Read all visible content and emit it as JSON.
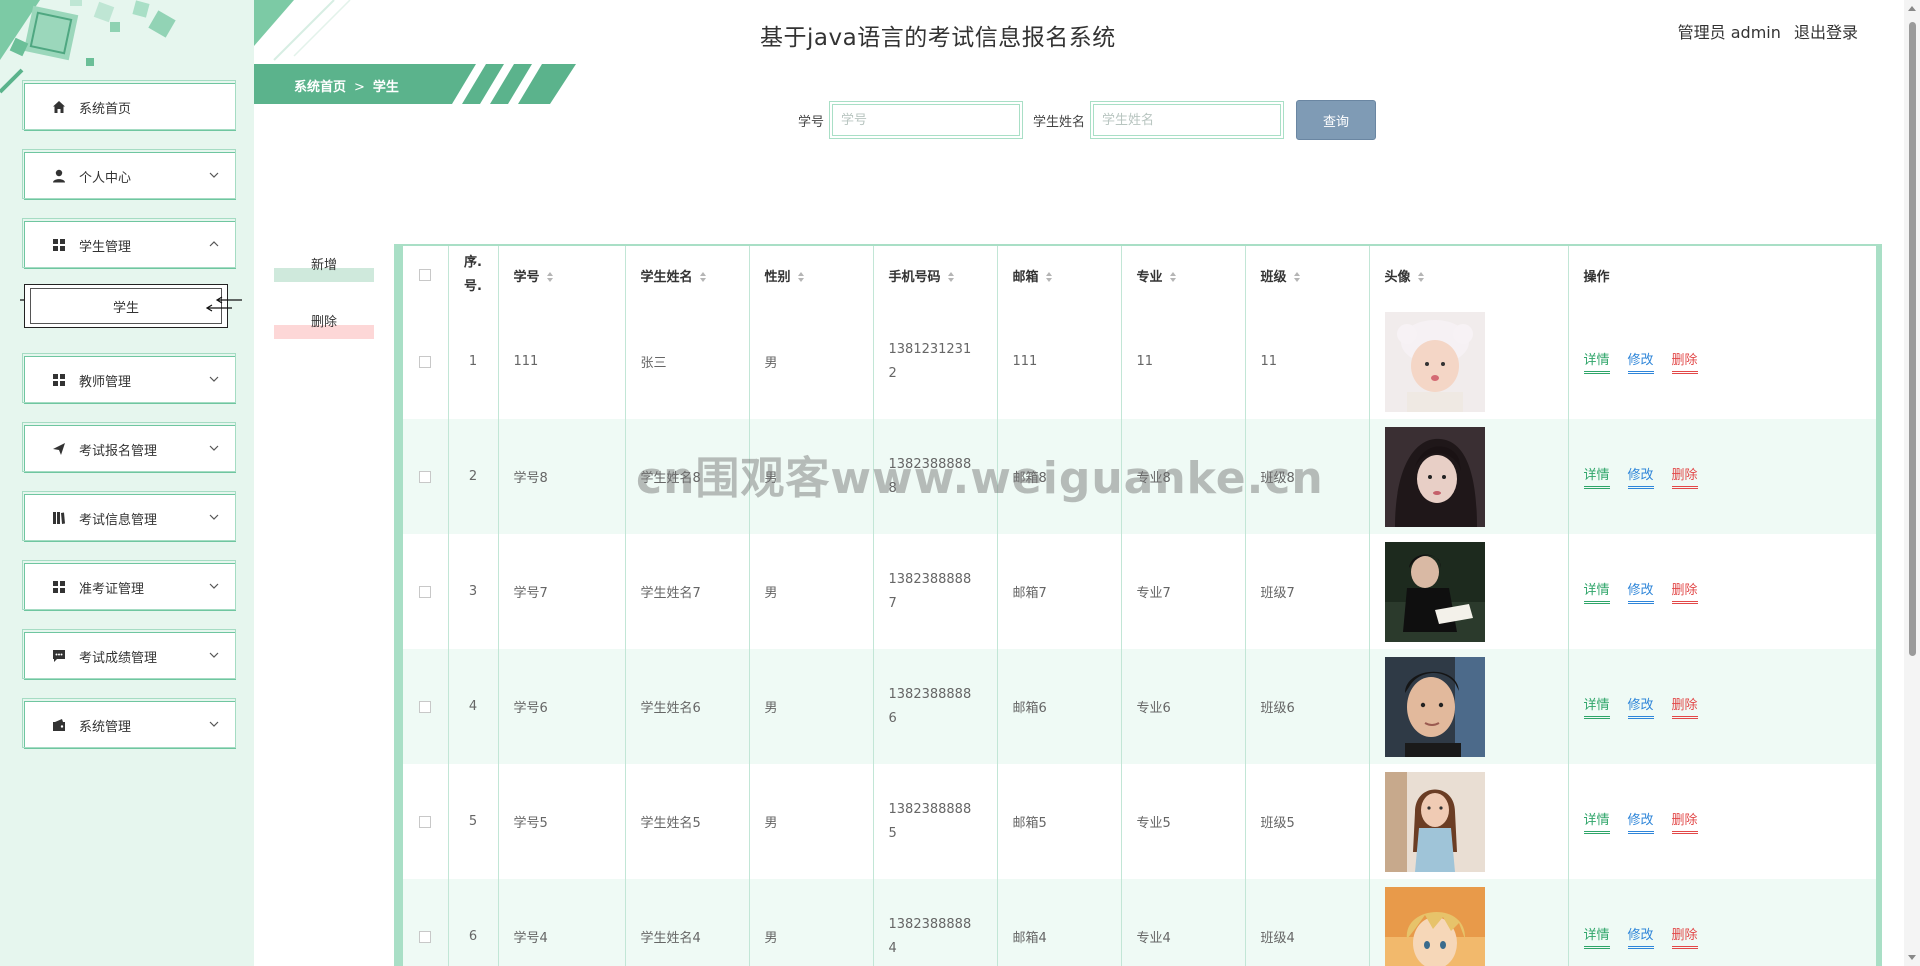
{
  "app": {
    "title": "基于java语言的考试信息报名系统",
    "user_label": "管理员 admin",
    "logout_label": "退出登录"
  },
  "sidebar": {
    "items": [
      {
        "label": "系统首页",
        "icon": "home-icon",
        "expanded": false,
        "has_chevron": false
      },
      {
        "label": "个人中心",
        "icon": "person-icon",
        "expanded": false,
        "has_chevron": true
      },
      {
        "label": "学生管理",
        "icon": "grid-icon",
        "expanded": true,
        "has_chevron": true
      },
      {
        "label": "教师管理",
        "icon": "grid-icon",
        "expanded": false,
        "has_chevron": true
      },
      {
        "label": "考试报名管理",
        "icon": "send-icon",
        "expanded": false,
        "has_chevron": true
      },
      {
        "label": "考试信息管理",
        "icon": "book-icon",
        "expanded": false,
        "has_chevron": true
      },
      {
        "label": "准考证管理",
        "icon": "grid-icon",
        "expanded": false,
        "has_chevron": true
      },
      {
        "label": "考试成绩管理",
        "icon": "chat-icon",
        "expanded": false,
        "has_chevron": true
      },
      {
        "label": "系统管理",
        "icon": "wallet-icon",
        "expanded": false,
        "has_chevron": true
      }
    ],
    "sub_item": {
      "label": "学生"
    }
  },
  "breadcrumb": {
    "home": "系统首页",
    "separator": ">",
    "current": "学生"
  },
  "search": {
    "student_no_label": "学号",
    "student_no_placeholder": "学号",
    "student_no_value": "",
    "student_name_label": "学生姓名",
    "student_name_placeholder": "学生姓名",
    "student_name_value": "",
    "button": "查询"
  },
  "actions": {
    "add": "新增",
    "delete": "删除"
  },
  "table": {
    "headers": {
      "index": "序.号.",
      "student_no": "学号",
      "student_name": "学生姓名",
      "gender": "性别",
      "phone": "手机号码",
      "email": "邮箱",
      "major": "专业",
      "class": "班级",
      "avatar": "头像",
      "ops": "操作"
    },
    "rows": [
      {
        "index": "1",
        "student_no": "111",
        "student_name": "张三",
        "gender": "男",
        "phone": "13812312312",
        "email": "111",
        "major": "11",
        "class": "11",
        "avatar": "girl-child-photo"
      },
      {
        "index": "2",
        "student_no": "学号8",
        "student_name": "学生姓名8",
        "gender": "男",
        "phone": "13823888888",
        "email": "邮箱8",
        "major": "专业8",
        "class": "班级8",
        "avatar": "woman-selfie-photo"
      },
      {
        "index": "3",
        "student_no": "学号7",
        "student_name": "学生姓名7",
        "gender": "男",
        "phone": "13823888887",
        "email": "邮箱7",
        "major": "专业7",
        "class": "班级7",
        "avatar": "man-reading-photo"
      },
      {
        "index": "4",
        "student_no": "学号6",
        "student_name": "学生姓名6",
        "gender": "男",
        "phone": "13823888886",
        "email": "邮箱6",
        "major": "专业6",
        "class": "班级6",
        "avatar": "man-portrait-photo"
      },
      {
        "index": "5",
        "student_no": "学号5",
        "student_name": "学生姓名5",
        "gender": "男",
        "phone": "13823888885",
        "email": "邮箱5",
        "major": "专业5",
        "class": "班级5",
        "avatar": "woman-street-photo"
      },
      {
        "index": "6",
        "student_no": "学号4",
        "student_name": "学生姓名4",
        "gender": "男",
        "phone": "13823888884",
        "email": "邮箱4",
        "major": "专业4",
        "class": "班级4",
        "avatar": "anime-boy-illustration"
      }
    ],
    "op_labels": {
      "detail": "详情",
      "edit": "修改",
      "delete": "删除"
    }
  },
  "watermark": "cn围观客www.weiguanke.cn",
  "colors": {
    "accent": "#5bb38c",
    "sidebar_bg": "#e6f6ee",
    "row_stripe": "#effaf5",
    "search_button": "#7f9bb5",
    "detail": "#2fa56a",
    "edit": "#2f86d9",
    "delete": "#e24848"
  }
}
